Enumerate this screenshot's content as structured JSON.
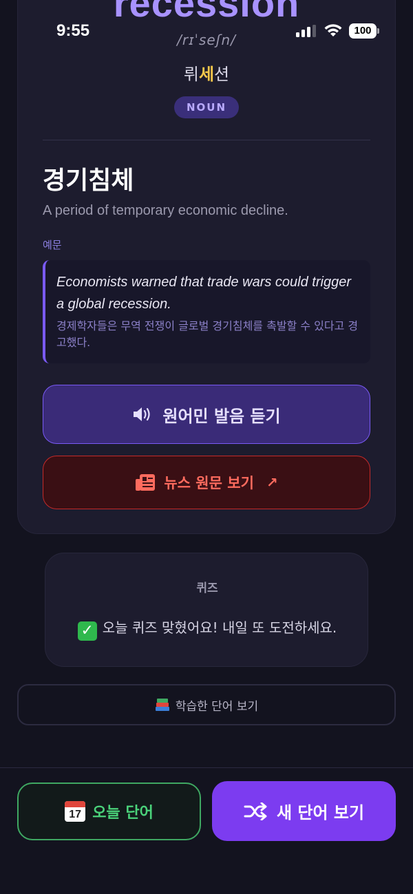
{
  "status_bar": {
    "time": "9:55",
    "battery": "100"
  },
  "word": {
    "headword": "recession",
    "ipa": "/rɪˈseʃn/",
    "pronunciation": {
      "before": "뤼",
      "stress": "세",
      "after": "션"
    },
    "part_of_speech": "NOUN",
    "meaning": "경기침체",
    "definition": "A period of temporary economic decline.",
    "example_label": "예문",
    "example_en": "Economists warned that trade wars could trigger a global recession.",
    "example_ko": "경제학자들은 무역 전쟁이 글로벌 경기침체를 촉발할 수 있다고 경고했다."
  },
  "actions": {
    "audio_label": "원어민 발음 듣기",
    "news_label": "뉴스 원문 보기",
    "news_arrow": "↗"
  },
  "quiz": {
    "title": "퀴즈",
    "message": "오늘 퀴즈 맞혔어요! 내일 또 도전하세요."
  },
  "learned_button": {
    "label": "학습한 단어 보기"
  },
  "bottom": {
    "today_label": "오늘 단어",
    "today_calendar_day": "17",
    "new_word_label": "새 단어 보기"
  },
  "colors": {
    "accent": "#7c3cf0",
    "headword": "#a892ff",
    "news": "#ff6b5e",
    "today": "#4ad27a",
    "stress": "#f5c84b"
  }
}
